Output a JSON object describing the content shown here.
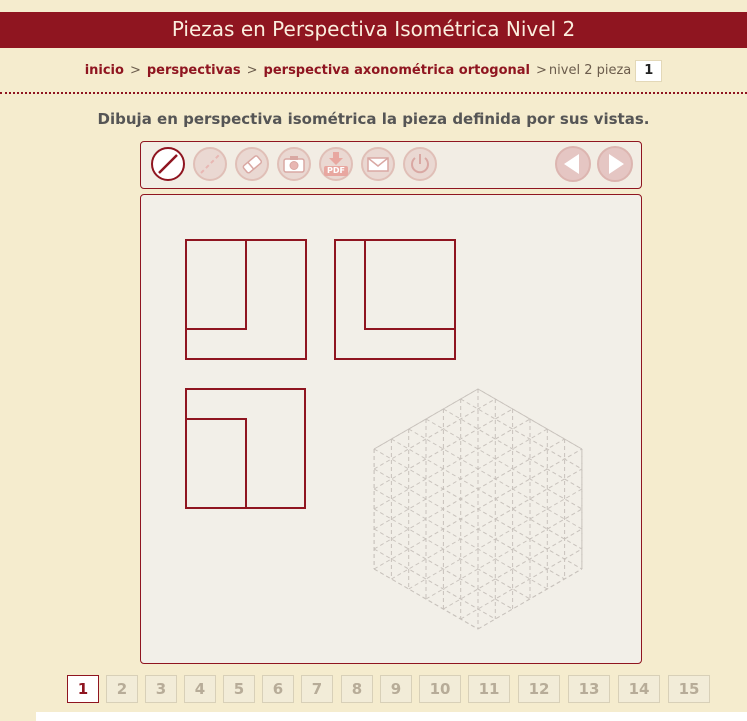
{
  "header": {
    "title": "Piezas en Perspectiva Isométrica Nivel 2"
  },
  "breadcrumb": {
    "inicio": "inicio",
    "perspectivas": "perspectivas",
    "axonometrica": "perspectiva axonométrica ortogonal",
    "sep": ">",
    "current": "nivel 2 pieza",
    "piece_number": "1"
  },
  "instruction": "Dibuja en perspectiva isométrica la pieza definida por sus vistas.",
  "toolbar": {
    "buttons": [
      {
        "name": "draw-line-tool",
        "icon": "line-icon",
        "active": true
      },
      {
        "name": "dashed-line-tool",
        "icon": "dashed-line-icon",
        "active": false
      },
      {
        "name": "eraser-tool",
        "icon": "eraser-icon",
        "active": false
      },
      {
        "name": "camera-button",
        "icon": "camera-icon",
        "active": false
      },
      {
        "name": "pdf-download-button",
        "icon": "pdf-download-icon",
        "label": "PDF",
        "active": false
      },
      {
        "name": "mail-button",
        "icon": "envelope-icon",
        "active": false
      },
      {
        "name": "power-button",
        "icon": "power-icon",
        "active": false
      }
    ],
    "nav": [
      {
        "name": "previous-button",
        "icon": "arrow-left-icon"
      },
      {
        "name": "next-button",
        "icon": "arrow-right-icon"
      }
    ]
  },
  "colors": {
    "accent": "#8f1520",
    "background": "#f5ecce",
    "canvas": "#f2efe8",
    "grid": "#c8c2bc"
  },
  "pager": {
    "pages": [
      "1",
      "2",
      "3",
      "4",
      "5",
      "6",
      "7",
      "8",
      "9",
      "10",
      "11",
      "12",
      "13",
      "14",
      "15"
    ],
    "active": "1"
  }
}
